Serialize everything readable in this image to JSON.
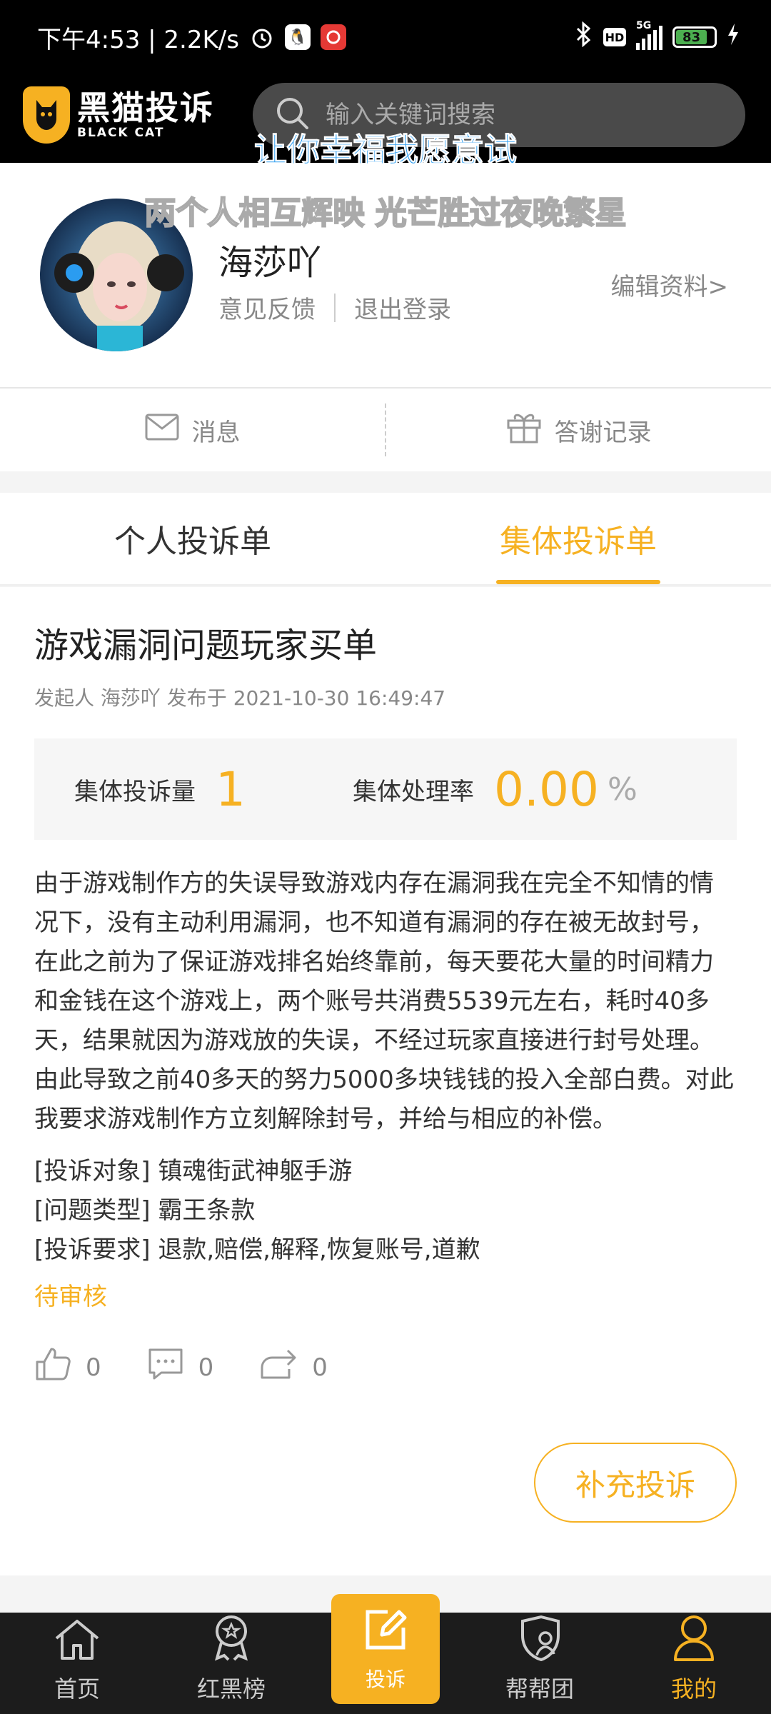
{
  "status_bar": {
    "time_speed": "下午4:53 | 2.2K/s",
    "battery": "83",
    "network": "5G"
  },
  "header": {
    "logo_cn": "黑猫投诉",
    "logo_en": "BLACK CAT",
    "search_placeholder": "输入关键词搜索"
  },
  "overlays": {
    "line1": "让你幸福我愿意试",
    "line2": "两个人相互辉映 光芒胜过夜晚繁星"
  },
  "profile": {
    "username": "海莎吖",
    "feedback": "意见反馈",
    "logout": "退出登录",
    "edit": "编辑资料>"
  },
  "quick": {
    "messages": "消息",
    "thanks": "答谢记录"
  },
  "tabs": {
    "personal": "个人投诉单",
    "group": "集体投诉单"
  },
  "complaint": {
    "title": "游戏漏洞问题玩家买单",
    "meta": "发起人 海莎吖 发布于 2021-10-30 16:49:47",
    "count_label": "集体投诉量",
    "count_value": "1",
    "rate_label": "集体处理率",
    "rate_value": "0.00",
    "rate_unit": "%",
    "description": "由于游戏制作方的失误导致游戏内存在漏洞我在完全不知情的情况下，没有主动利用漏洞，也不知道有漏洞的存在被无故封号，在此之前为了保证游戏排名始终靠前，每天要花大量的时间精力和金钱在这个游戏上，两个账号共消费5539元左右，耗时40多天，结果就因为游戏放的失误，不经过玩家直接进行封号处理。由此导致之前40多天的努力5000多块钱钱的投入全部白费。对此我要求游戏制作方立刻解除封号，并给与相应的补偿。",
    "target": "[投诉对象] 镇魂街武神躯手游",
    "issue_type": "[问题类型] 霸王条款",
    "demand": "[投诉要求] 退款,赔偿,解释,恢复账号,道歉",
    "status": "待审核",
    "likes": "0",
    "comments": "0",
    "shares": "0",
    "supplement_btn": "补充投诉"
  },
  "nav": {
    "home": "首页",
    "ranking": "红黑榜",
    "complain": "投诉",
    "help": "帮帮团",
    "mine": "我的"
  },
  "colors": {
    "accent": "#f6b122",
    "header_bg": "#000000",
    "nav_bg": "#1c1c1c"
  }
}
